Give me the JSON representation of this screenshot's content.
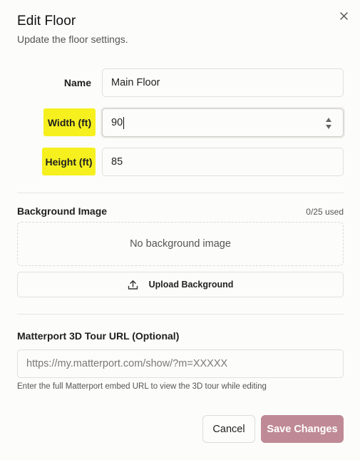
{
  "dialog": {
    "title": "Edit Floor",
    "subtitle": "Update the floor settings."
  },
  "form": {
    "name_label": "Name",
    "name_value": "Main Floor",
    "width_label": "Width (ft)",
    "width_value": "90",
    "height_label": "Height (ft)",
    "height_value": "85"
  },
  "background": {
    "section_title": "Background Image",
    "usage": "0/25 used",
    "empty_text": "No background image",
    "upload_label": "Upload Background"
  },
  "matterport": {
    "section_title": "Matterport 3D Tour URL (Optional)",
    "placeholder": "https://my.matterport.com/show/?m=XXXXX",
    "help": "Enter the full Matterport embed URL to view the 3D tour while editing"
  },
  "actions": {
    "cancel_label": "Cancel",
    "save_label": "Save Changes"
  },
  "colors": {
    "highlight": "#f5f01e",
    "save_button": "#bf8a95"
  },
  "icons": {
    "close": "close-icon",
    "spinner": "spinner-arrows-icon",
    "upload": "upload-icon"
  }
}
